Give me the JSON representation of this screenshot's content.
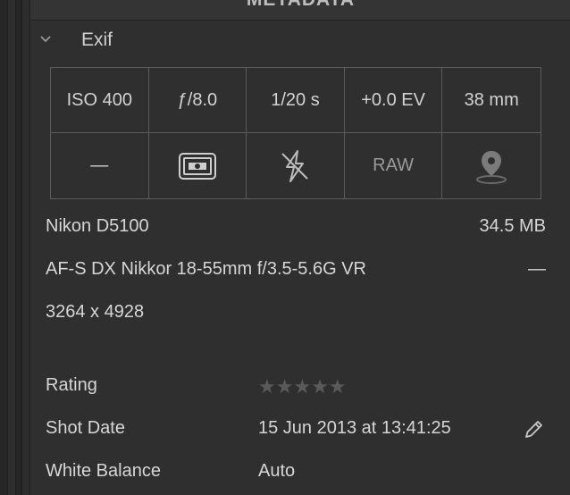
{
  "panel": {
    "title": "METADATA"
  },
  "section": {
    "label": "Exif",
    "collapse_icon": "chevron-down-icon"
  },
  "exif": {
    "iso": "ISO 400",
    "aperture": "ƒ/8.0",
    "shutter": "1/20 s",
    "exposure_comp": "+0.0 EV",
    "focal_length": "38 mm",
    "flash_mode": "—",
    "metering_icon": "metering-icon",
    "flash_icon": "flash-off-icon",
    "format": "RAW",
    "location_icon": "location-pin-icon"
  },
  "camera": {
    "model": "Nikon D5100",
    "file_size": "34.5 MB",
    "lens": "AF-S DX Nikkor 18-55mm f/3.5-5.6G VR",
    "lens_extra": "—",
    "dimensions": "3264 x 4928"
  },
  "fields": {
    "rating_label": "Rating",
    "rating_value": "★★★★★",
    "rating_stars": 0,
    "shot_date_label": "Shot Date",
    "shot_date_value": "15 Jun 2013 at 13:41:25",
    "white_balance_label": "White Balance",
    "white_balance_value": "Auto"
  }
}
